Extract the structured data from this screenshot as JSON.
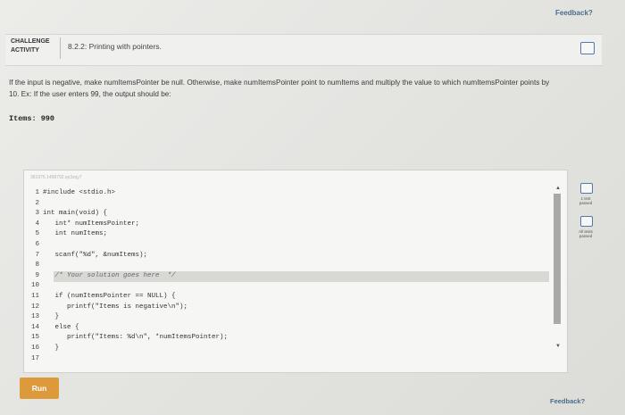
{
  "feedback_top": "Feedback?",
  "feedback_bottom": "Feedback?",
  "challenge": {
    "label_line1": "CHALLENGE",
    "label_line2": "ACTIVITY",
    "title": "8.2.2: Printing with pointers."
  },
  "instructions": "If the input is negative, make numItemsPointer be null. Otherwise, make numItemsPointer point to numItems and multiply the value to which numItemsPointer points by 10. Ex: If the user enters 99, the output should be:",
  "example_output": "Items: 990",
  "editor": {
    "id_text": "381976.1458792.qx3zqy7",
    "lines": [
      {
        "num": "1",
        "text": "#include <stdio.h>"
      },
      {
        "num": "2",
        "text": ""
      },
      {
        "num": "3",
        "text": "int main(void) {"
      },
      {
        "num": "4",
        "text": "   int* numItemsPointer;"
      },
      {
        "num": "5",
        "text": "   int numItems;"
      },
      {
        "num": "6",
        "text": ""
      },
      {
        "num": "7",
        "text": "   scanf(\"%d\", &numItems);"
      },
      {
        "num": "8",
        "text": ""
      },
      {
        "num": "9",
        "text": "   /* Your solution goes here  */"
      },
      {
        "num": "10",
        "text": ""
      },
      {
        "num": "11",
        "text": "   if (numItemsPointer == NULL) {"
      },
      {
        "num": "12",
        "text": "      printf(\"Items is negative\\n\");"
      },
      {
        "num": "13",
        "text": "   }"
      },
      {
        "num": "14",
        "text": "   else {"
      },
      {
        "num": "15",
        "text": "      printf(\"Items: %d\\n\", *numItemsPointer);"
      },
      {
        "num": "16",
        "text": "   }"
      },
      {
        "num": "17",
        "text": ""
      }
    ]
  },
  "side_status": {
    "test1_line1": "1 test",
    "test1_line2": "passed",
    "test2_line1": "All tests",
    "test2_line2": "passed"
  },
  "run_label": "Run",
  "colors": {
    "run_button": "#dd9a3b",
    "status_border": "#5577aa",
    "link": "#4a6d8c"
  }
}
